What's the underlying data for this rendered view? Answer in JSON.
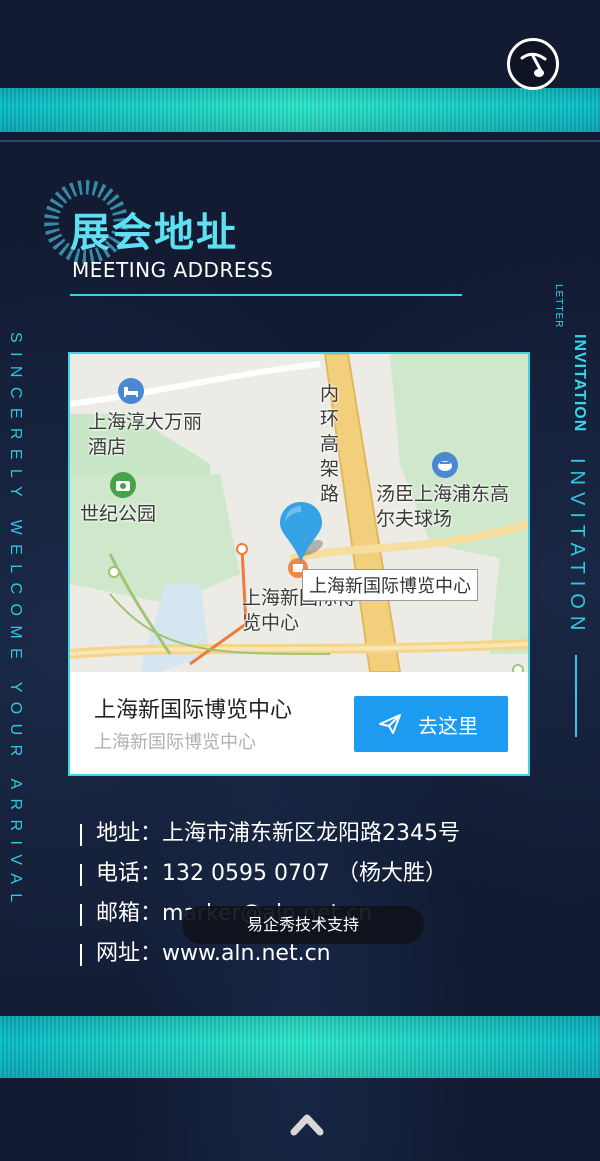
{
  "section": {
    "title_zh": "展会地址",
    "title_en": "MEETING ADDRESS"
  },
  "side_text": {
    "left": "SINCERELY WELCOME YOUR ARRIVAL",
    "right_invitation": "INVITATION",
    "right_letter": "LETTER",
    "right_invitation_outline": "INVITATION"
  },
  "map": {
    "labels": {
      "hotel": "上海淳大万丽酒店",
      "park": "世纪公园",
      "road": "内环高架路",
      "golf": "汤臣上海浦东高尔夫球场",
      "venue": "上海新国际博览中心"
    },
    "callout": "上海新国际博览中心",
    "place_name": "上海新国际博览中心",
    "place_sub": "上海新国际博览中心",
    "go_button": "去这里"
  },
  "contact": {
    "address": "地址：上海市浦东新区龙阳路2345号",
    "phone": "电话：132 0595 0707 （杨大胜）",
    "email": "邮箱：marker@aln.net.cn",
    "website": "网址：www.aln.net.cn"
  },
  "toast": "易企秀技术支持",
  "icons": {
    "music": "music-note-icon",
    "hotel": "bed-icon",
    "park": "camera-icon",
    "golf": "golf-icon",
    "venue": "venue-icon",
    "marker": "map-pin-icon",
    "navigate": "paper-plane-icon",
    "scroll": "chevron-up-icon"
  },
  "colors": {
    "accent": "#3fd1e6",
    "background": "#131b33",
    "button": "#1d9bf0"
  }
}
